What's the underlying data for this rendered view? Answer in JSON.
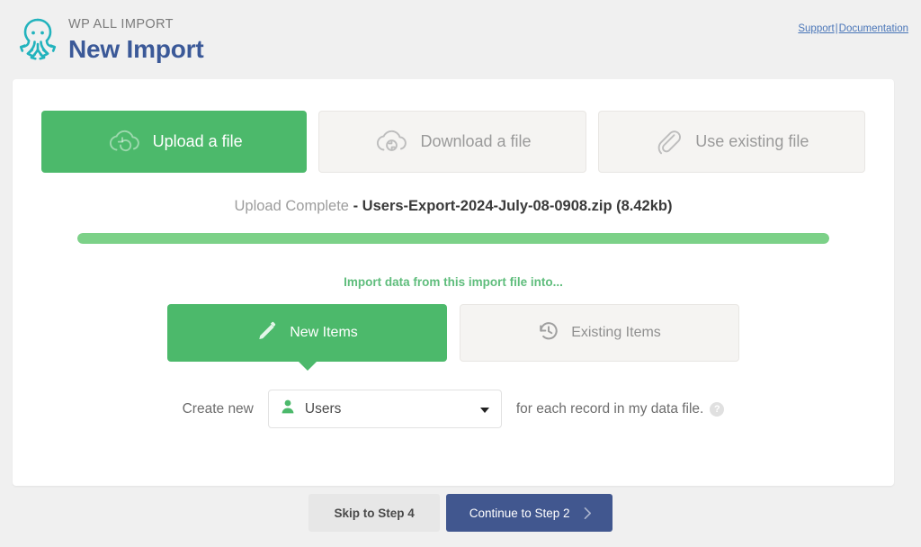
{
  "header": {
    "brand_kicker": "WP ALL IMPORT",
    "page_title": "New Import",
    "logo_icon": "octopus-logo-icon",
    "links": {
      "support": "Support",
      "separator": "|",
      "documentation": "Documentation"
    }
  },
  "source_tabs": [
    {
      "label": "Upload a file",
      "icon": "cloud-upload-icon",
      "active": true
    },
    {
      "label": "Download a file",
      "icon": "cloud-download-icon",
      "active": false
    },
    {
      "label": "Use existing file",
      "icon": "paperclip-icon",
      "active": false
    }
  ],
  "upload": {
    "status_label": "Upload Complete",
    "dash": "-",
    "file_name": "Users-Export-2024-July-08-0908.zip (8.42kb)",
    "progress_percent": 100
  },
  "import_into": {
    "heading": "Import data from this import file into...",
    "mode_tabs": [
      {
        "label": "New Items",
        "icon": "pencil-icon",
        "active": true
      },
      {
        "label": "Existing Items",
        "icon": "history-icon",
        "active": false
      }
    ]
  },
  "create_row": {
    "prefix_label": "Create new",
    "select": {
      "value": "Users",
      "icon": "user-icon",
      "caret_icon": "chevron-down-icon"
    },
    "suffix_label": "for each record in my data file.",
    "help_icon_label": "?"
  },
  "footer": {
    "skip_label": "Skip to Step 4",
    "continue_label": "Continue to Step 2",
    "continue_chevron_icon": "chevron-right-icon"
  },
  "colors": {
    "accent_green": "#4cb96b",
    "progress_green": "#7cd188",
    "title_blue": "#3b5998",
    "primary_button_blue": "#41578f",
    "logo_teal": "#22b3bd",
    "link_blue": "#4a76b8",
    "page_background": "#f0f0f0"
  }
}
